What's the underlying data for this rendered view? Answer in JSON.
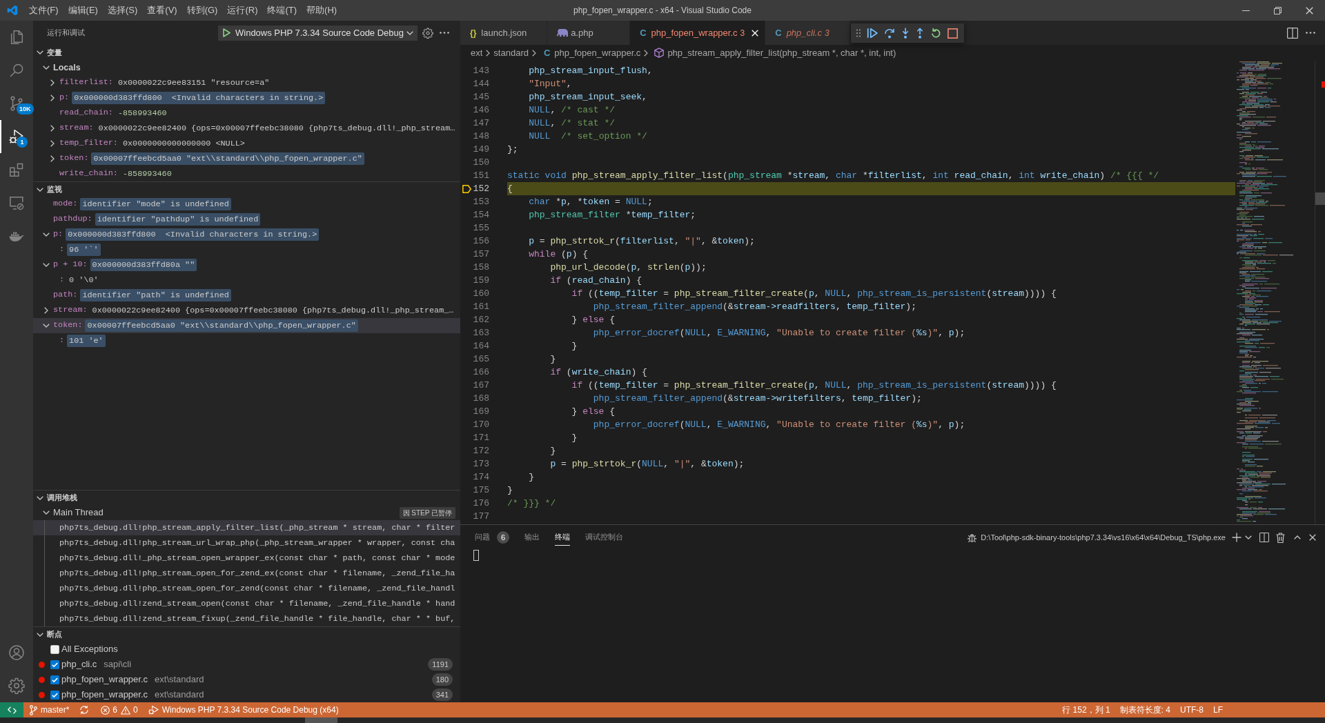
{
  "title_bar": {
    "menu": [
      "文件(F)",
      "编辑(E)",
      "选择(S)",
      "查看(V)",
      "转到(G)",
      "运行(R)",
      "终端(T)",
      "帮助(H)"
    ],
    "title": "php_fopen_wrapper.c - x64 - Visual Studio Code"
  },
  "activity_bar": [
    {
      "selected": false
    },
    {
      "selected": false
    },
    {
      "selected": false,
      "badge": "10K"
    },
    {
      "selected": true,
      "badge": "1"
    },
    {
      "selected": false
    },
    {
      "selected": false
    },
    {
      "selected": false
    }
  ],
  "sidebar": {
    "title": "运行和调试",
    "launch_config": "Windows PHP 7.3.34 Source Code Debug",
    "variables": {
      "title": "变量",
      "expanded": true,
      "scopes": [
        {
          "name": "Locals",
          "expanded": true,
          "items": [
            {
              "name": "filterlist:",
              "value": "0x0000022c9ee83151 \"resource=a\"",
              "kind": "text",
              "expanded": false,
              "changed": false,
              "selected": false
            },
            {
              "name": "p:",
              "value": "0x000000d383ffd800  <Invalid characters in string.>",
              "kind": "text",
              "expanded": false,
              "changed": true,
              "selected": false
            },
            {
              "name": "read_chain:",
              "value": "-858993460",
              "kind": "number",
              "changed": false,
              "selected": false
            },
            {
              "name": "stream:",
              "value": "0x0000022c9ee82400 {ops=0x00007ffeebc38080 {php7ts_debug.dll!_php_stream…",
              "kind": "text",
              "expanded": false,
              "changed": false,
              "selected": false
            },
            {
              "name": "temp_filter:",
              "value": "0x0000000000000000 <NULL>",
              "kind": "text",
              "expanded": false,
              "changed": false,
              "selected": false
            },
            {
              "name": "token:",
              "value": "0x00007ffeebcd5aa0 \"ext\\\\standard\\\\php_fopen_wrapper.c\"",
              "kind": "text",
              "expanded": false,
              "changed": true,
              "selected": false
            },
            {
              "name": "write_chain:",
              "value": "-858993460",
              "kind": "number",
              "changed": false,
              "selected": false
            }
          ]
        }
      ]
    },
    "watch": {
      "title": "监视",
      "expanded": true,
      "items": [
        {
          "name": "mode:",
          "value": "identifier \"mode\" is undefined",
          "kind": "text",
          "changed": true,
          "selected": false
        },
        {
          "name": "pathdup:",
          "value": "identifier \"pathdup\" is undefined",
          "kind": "text",
          "changed": true,
          "selected": false
        },
        {
          "name": "p:",
          "value": "0x000000d383ffd800  <Invalid characters in string.>",
          "kind": "text",
          "expanded": true,
          "changed": true,
          "selected": false,
          "children": [
            {
              "name": ":",
              "value": "96 '`'",
              "kind": "text",
              "changed": true,
              "selected": false
            }
          ]
        },
        {
          "name": "p + 10:",
          "value": "0x000000d383ffd80a \"\"",
          "kind": "text",
          "expanded": true,
          "changed": true,
          "selected": false,
          "children": [
            {
              "name": ":",
              "value": "0 '\\0'",
              "kind": "text",
              "changed": false,
              "selected": false
            }
          ]
        },
        {
          "name": "path:",
          "value": "identifier \"path\" is undefined",
          "kind": "text",
          "changed": true,
          "selected": false
        },
        {
          "name": "stream:",
          "value": "0x0000022c9ee82400 {ops=0x00007ffeebc38080 {php7ts_debug.dll!_php_stream_…",
          "kind": "text",
          "expanded": false,
          "changed": false,
          "selected": false
        },
        {
          "name": "token:",
          "value": "0x00007ffeebcd5aa0 \"ext\\\\standard\\\\php_fopen_wrapper.c\"",
          "kind": "text",
          "expanded": true,
          "changed": true,
          "selected": true,
          "children": [
            {
              "name": ":",
              "value": "101 'e'",
              "kind": "text",
              "changed": true,
              "selected": false
            }
          ]
        }
      ]
    },
    "call_stack": {
      "title": "调用堆栈",
      "expanded": true,
      "threads": [
        {
          "name": "Main Thread",
          "expanded": true,
          "status": "因 STEP 已暂停",
          "frames": [
            {
              "label": "php7ts_debug.dll!php_stream_apply_filter_list(_php_stream * stream, char * filter",
              "selected": true
            },
            {
              "label": "php7ts_debug.dll!php_stream_url_wrap_php(_php_stream_wrapper * wrapper, const cha",
              "selected": false
            },
            {
              "label": "php7ts_debug.dll!_php_stream_open_wrapper_ex(const char * path, const char * mode",
              "selected": false
            },
            {
              "label": "php7ts_debug.dll!php_stream_open_for_zend_ex(const char * filename, _zend_file_ha",
              "selected": false
            },
            {
              "label": "php7ts_debug.dll!php_stream_open_for_zend(const char * filename, _zend_file_handl",
              "selected": false
            },
            {
              "label": "php7ts_debug.dll!zend_stream_open(const char * filename, _zend_file_handle * hand",
              "selected": false
            },
            {
              "label": "php7ts_debug.dll!zend_stream_fixup(_zend_file_handle * file_handle, char * * buf,",
              "selected": false
            }
          ]
        }
      ]
    },
    "breakpoints": {
      "title": "断点",
      "expanded": true,
      "items": [
        {
          "kind": "exception",
          "label": "All Exceptions",
          "checked": false
        },
        {
          "kind": "line",
          "label": "php_cli.c",
          "path": "sapi\\cli",
          "line": "1191",
          "checked": true
        },
        {
          "kind": "line",
          "label": "php_fopen_wrapper.c",
          "path": "ext\\standard",
          "line": "180",
          "checked": true
        },
        {
          "kind": "line",
          "label": "php_fopen_wrapper.c",
          "path": "ext\\standard",
          "line": "341",
          "checked": true
        }
      ]
    }
  },
  "editor": {
    "tabs": [
      {
        "label": "launch.json",
        "icon": "{}",
        "kind": "json",
        "selected": false,
        "preview": false
      },
      {
        "label": "a.php",
        "kind": "php",
        "selected": false,
        "preview": false
      },
      {
        "label": "php_fopen_wrapper.c",
        "icon": "C",
        "kind": "c",
        "problems": "3",
        "selected": true,
        "preview": false
      },
      {
        "label": "php_cli.c",
        "icon": "C",
        "kind": "c",
        "problems": "3",
        "selected": false,
        "preview": true
      }
    ],
    "breadcrumb": [
      {
        "label": "ext",
        "kind": "folder"
      },
      {
        "label": "standard",
        "kind": "folder"
      },
      {
        "label": "php_fopen_wrapper.c",
        "kind": "file",
        "icon": "C"
      },
      {
        "label": "php_stream_apply_filter_list(php_stream *, char *, int, int)",
        "kind": "symbol"
      }
    ],
    "lines": [
      {
        "number": "143",
        "current": false,
        "code": [
          {
            "kind": "var",
            "text": "    php_stream_input_flush"
          },
          {
            "kind": "punc",
            "text": ","
          }
        ]
      },
      {
        "number": "144",
        "current": false,
        "code": [
          {
            "kind": "str",
            "text": "    \"Input\""
          },
          {
            "kind": "punc",
            "text": ","
          }
        ]
      },
      {
        "number": "145",
        "current": false,
        "code": [
          {
            "kind": "var",
            "text": "    php_stream_input_seek"
          },
          {
            "kind": "punc",
            "text": ","
          }
        ]
      },
      {
        "number": "146",
        "current": false,
        "code": [
          {
            "kind": "kw",
            "text": "    NULL"
          },
          {
            "kind": "punc",
            "text": ", "
          },
          {
            "kind": "cm",
            "text": "/* cast */"
          }
        ]
      },
      {
        "number": "147",
        "current": false,
        "code": [
          {
            "kind": "kw",
            "text": "    NULL"
          },
          {
            "kind": "punc",
            "text": ", "
          },
          {
            "kind": "cm",
            "text": "/* stat */"
          }
        ]
      },
      {
        "number": "148",
        "current": false,
        "code": [
          {
            "kind": "kw",
            "text": "    NULL"
          },
          {
            "kind": "cm",
            "text": "  /* set_option */"
          }
        ]
      },
      {
        "number": "149",
        "current": false,
        "code": [
          {
            "kind": "punc",
            "text": "};"
          }
        ]
      },
      {
        "number": "150",
        "current": false
      },
      {
        "number": "151",
        "current": false,
        "code": [
          {
            "kind": "kw",
            "text": "static void"
          },
          {
            "kind": "fn",
            "text": " php_stream_apply_filter_list"
          },
          {
            "kind": "punc",
            "text": "("
          },
          {
            "kind": "type",
            "text": "php_stream"
          },
          {
            "kind": "punc",
            "text": " *"
          },
          {
            "kind": "var",
            "text": "stream"
          },
          {
            "kind": "punc",
            "text": ", "
          },
          {
            "kind": "kw",
            "text": "char"
          },
          {
            "kind": "punc",
            "text": " *"
          },
          {
            "kind": "var",
            "text": "filterlist"
          },
          {
            "kind": "punc",
            "text": ", "
          },
          {
            "kind": "kw",
            "text": "int"
          },
          {
            "kind": "var",
            "text": " read_chain"
          },
          {
            "kind": "punc",
            "text": ", "
          },
          {
            "kind": "kw",
            "text": "int"
          },
          {
            "kind": "var",
            "text": " write_chain"
          },
          {
            "kind": "punc",
            "text": ") "
          },
          {
            "kind": "cm",
            "text": "/* {{{ */"
          }
        ]
      },
      {
        "number": "152",
        "current": true,
        "code": [
          {
            "kind": "punc",
            "text": "{"
          }
        ]
      },
      {
        "number": "153",
        "current": false,
        "code": [
          {
            "kind": "kw",
            "text": "    char"
          },
          {
            "kind": "punc",
            "text": " *"
          },
          {
            "kind": "var",
            "text": "p"
          },
          {
            "kind": "punc",
            "text": ", *"
          },
          {
            "kind": "var",
            "text": "token"
          },
          {
            "kind": "punc",
            "text": " = "
          },
          {
            "kind": "kw",
            "text": "NULL"
          },
          {
            "kind": "punc",
            "text": ";"
          }
        ]
      },
      {
        "number": "154",
        "current": false,
        "code": [
          {
            "kind": "type",
            "text": "    php_stream_filter"
          },
          {
            "kind": "punc",
            "text": " *"
          },
          {
            "kind": "var",
            "text": "temp_filter"
          },
          {
            "kind": "punc",
            "text": ";"
          }
        ]
      },
      {
        "number": "155",
        "current": false
      },
      {
        "number": "156",
        "current": false,
        "code": [
          {
            "kind": "var",
            "text": "    p"
          },
          {
            "kind": "punc",
            "text": " = "
          },
          {
            "kind": "fn",
            "text": "php_strtok_r"
          },
          {
            "kind": "punc",
            "text": "("
          },
          {
            "kind": "var",
            "text": "filterlist"
          },
          {
            "kind": "punc",
            "text": ", "
          },
          {
            "kind": "str",
            "text": "\"|\""
          },
          {
            "kind": "punc",
            "text": ", &"
          },
          {
            "kind": "var",
            "text": "token"
          },
          {
            "kind": "punc",
            "text": ");"
          }
        ]
      },
      {
        "number": "157",
        "current": false,
        "code": [
          {
            "kind": "ctrl",
            "text": "    while"
          },
          {
            "kind": "punc",
            "text": " ("
          },
          {
            "kind": "var",
            "text": "p"
          },
          {
            "kind": "punc",
            "text": ") {"
          }
        ]
      },
      {
        "number": "158",
        "current": false,
        "code": [
          {
            "kind": "fn",
            "text": "        php_url_decode"
          },
          {
            "kind": "punc",
            "text": "("
          },
          {
            "kind": "var",
            "text": "p"
          },
          {
            "kind": "punc",
            "text": ", "
          },
          {
            "kind": "fn",
            "text": "strlen"
          },
          {
            "kind": "punc",
            "text": "("
          },
          {
            "kind": "var",
            "text": "p"
          },
          {
            "kind": "punc",
            "text": "));"
          }
        ]
      },
      {
        "number": "159",
        "current": false,
        "code": [
          {
            "kind": "ctrl",
            "text": "        if"
          },
          {
            "kind": "punc",
            "text": " ("
          },
          {
            "kind": "var",
            "text": "read_chain"
          },
          {
            "kind": "punc",
            "text": ") {"
          }
        ]
      },
      {
        "number": "160",
        "current": false,
        "code": [
          {
            "kind": "ctrl",
            "text": "            if"
          },
          {
            "kind": "punc",
            "text": " (("
          },
          {
            "kind": "var",
            "text": "temp_filter"
          },
          {
            "kind": "punc",
            "text": " = "
          },
          {
            "kind": "fn",
            "text": "php_stream_filter_create"
          },
          {
            "kind": "punc",
            "text": "("
          },
          {
            "kind": "var",
            "text": "p"
          },
          {
            "kind": "punc",
            "text": ", "
          },
          {
            "kind": "kw",
            "text": "NULL"
          },
          {
            "kind": "punc",
            "text": ", "
          },
          {
            "kind": "kw",
            "text": "php_stream_is_persistent"
          },
          {
            "kind": "punc",
            "text": "("
          },
          {
            "kind": "var",
            "text": "stream"
          },
          {
            "kind": "punc",
            "text": ")))) {"
          }
        ]
      },
      {
        "number": "161",
        "current": false,
        "code": [
          {
            "kind": "kw",
            "text": "                php_stream_filter_append"
          },
          {
            "kind": "punc",
            "text": "(&"
          },
          {
            "kind": "var",
            "text": "stream->readfilters"
          },
          {
            "kind": "punc",
            "text": ", "
          },
          {
            "kind": "var",
            "text": "temp_filter"
          },
          {
            "kind": "punc",
            "text": ");"
          }
        ]
      },
      {
        "number": "162",
        "current": false,
        "code": [
          {
            "kind": "punc",
            "text": "            } "
          },
          {
            "kind": "ctrl",
            "text": "else"
          },
          {
            "kind": "punc",
            "text": " {"
          }
        ]
      },
      {
        "number": "163",
        "current": false,
        "code": [
          {
            "kind": "kw",
            "text": "                php_error_docref"
          },
          {
            "kind": "punc",
            "text": "("
          },
          {
            "kind": "kw",
            "text": "NULL"
          },
          {
            "kind": "punc",
            "text": ", "
          },
          {
            "kind": "kw",
            "text": "E_WARNING"
          },
          {
            "kind": "punc",
            "text": ", "
          },
          {
            "kind": "str",
            "text": "\"Unable to create filter ("
          },
          {
            "kind": "esc",
            "text": "%s"
          },
          {
            "kind": "str",
            "text": ")\""
          },
          {
            "kind": "punc",
            "text": ", "
          },
          {
            "kind": "var",
            "text": "p"
          },
          {
            "kind": "punc",
            "text": ");"
          }
        ]
      },
      {
        "number": "164",
        "current": false,
        "code": [
          {
            "kind": "punc",
            "text": "            }"
          }
        ]
      },
      {
        "number": "165",
        "current": false,
        "code": [
          {
            "kind": "punc",
            "text": "        }"
          }
        ]
      },
      {
        "number": "166",
        "current": false,
        "code": [
          {
            "kind": "ctrl",
            "text": "        if"
          },
          {
            "kind": "punc",
            "text": " ("
          },
          {
            "kind": "var",
            "text": "write_chain"
          },
          {
            "kind": "punc",
            "text": ") {"
          }
        ]
      },
      {
        "number": "167",
        "current": false,
        "code": [
          {
            "kind": "ctrl",
            "text": "            if"
          },
          {
            "kind": "punc",
            "text": " (("
          },
          {
            "kind": "var",
            "text": "temp_filter"
          },
          {
            "kind": "punc",
            "text": " = "
          },
          {
            "kind": "fn",
            "text": "php_stream_filter_create"
          },
          {
            "kind": "punc",
            "text": "("
          },
          {
            "kind": "var",
            "text": "p"
          },
          {
            "kind": "punc",
            "text": ", "
          },
          {
            "kind": "kw",
            "text": "NULL"
          },
          {
            "kind": "punc",
            "text": ", "
          },
          {
            "kind": "kw",
            "text": "php_stream_is_persistent"
          },
          {
            "kind": "punc",
            "text": "("
          },
          {
            "kind": "var",
            "text": "stream"
          },
          {
            "kind": "punc",
            "text": ")))) {"
          }
        ]
      },
      {
        "number": "168",
        "current": false,
        "code": [
          {
            "kind": "kw",
            "text": "                php_stream_filter_append"
          },
          {
            "kind": "punc",
            "text": "(&"
          },
          {
            "kind": "var",
            "text": "stream->writefilters"
          },
          {
            "kind": "punc",
            "text": ", "
          },
          {
            "kind": "var",
            "text": "temp_filter"
          },
          {
            "kind": "punc",
            "text": ");"
          }
        ]
      },
      {
        "number": "169",
        "current": false,
        "code": [
          {
            "kind": "punc",
            "text": "            } "
          },
          {
            "kind": "ctrl",
            "text": "else"
          },
          {
            "kind": "punc",
            "text": " {"
          }
        ]
      },
      {
        "number": "170",
        "current": false,
        "code": [
          {
            "kind": "kw",
            "text": "                php_error_docref"
          },
          {
            "kind": "punc",
            "text": "("
          },
          {
            "kind": "kw",
            "text": "NULL"
          },
          {
            "kind": "punc",
            "text": ", "
          },
          {
            "kind": "kw",
            "text": "E_WARNING"
          },
          {
            "kind": "punc",
            "text": ", "
          },
          {
            "kind": "str",
            "text": "\"Unable to create filter ("
          },
          {
            "kind": "esc",
            "text": "%s"
          },
          {
            "kind": "str",
            "text": ")\""
          },
          {
            "kind": "punc",
            "text": ", "
          },
          {
            "kind": "var",
            "text": "p"
          },
          {
            "kind": "punc",
            "text": ");"
          }
        ]
      },
      {
        "number": "171",
        "current": false,
        "code": [
          {
            "kind": "punc",
            "text": "            }"
          }
        ]
      },
      {
        "number": "172",
        "current": false,
        "code": [
          {
            "kind": "punc",
            "text": "        }"
          }
        ]
      },
      {
        "number": "173",
        "current": false,
        "code": [
          {
            "kind": "var",
            "text": "        p"
          },
          {
            "kind": "punc",
            "text": " = "
          },
          {
            "kind": "fn",
            "text": "php_strtok_r"
          },
          {
            "kind": "punc",
            "text": "("
          },
          {
            "kind": "kw",
            "text": "NULL"
          },
          {
            "kind": "punc",
            "text": ", "
          },
          {
            "kind": "str",
            "text": "\"|\""
          },
          {
            "kind": "punc",
            "text": ", &"
          },
          {
            "kind": "var",
            "text": "token"
          },
          {
            "kind": "punc",
            "text": ");"
          }
        ]
      },
      {
        "number": "174",
        "current": false,
        "code": [
          {
            "kind": "punc",
            "text": "    }"
          }
        ]
      },
      {
        "number": "175",
        "current": false,
        "code": [
          {
            "kind": "punc",
            "text": "}"
          }
        ]
      },
      {
        "number": "176",
        "current": false,
        "code": [
          {
            "kind": "cm",
            "text": "/* }}} */"
          }
        ]
      },
      {
        "number": "177",
        "current": false
      }
    ]
  },
  "panel": {
    "tabs": [
      {
        "label": "问题",
        "badge": "6",
        "selected": false
      },
      {
        "label": "输出",
        "selected": false
      },
      {
        "label": "终端",
        "selected": true
      },
      {
        "label": "调试控制台",
        "selected": false
      }
    ],
    "terminal": "D:\\Tool\\php-sdk-binary-tools\\php7.3.34\\vs16\\x64\\x64\\Debug_TS\\php.exe"
  },
  "status_bar": {
    "branch": "master*",
    "errors": "6",
    "warnings": "0",
    "debug_target": "Windows PHP 7.3.34 Source Code Debug (x64)",
    "right": [
      "行 152，列 1",
      "制表符长度: 4",
      "UTF-8",
      "LF"
    ]
  }
}
